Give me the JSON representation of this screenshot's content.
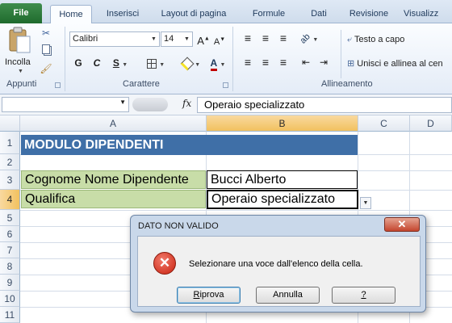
{
  "ribbon_tabs": [
    "File",
    "Home",
    "Inserisci",
    "Layout di pagina",
    "Formule",
    "Dati",
    "Revisione",
    "Visualizz"
  ],
  "clipboard": {
    "paste_label": "Incolla",
    "group_label": "Appunti"
  },
  "font": {
    "name": "Calibri",
    "size": "14",
    "bold": "G",
    "italic": "C",
    "underline": "S",
    "group_label": "Carattere"
  },
  "alignment": {
    "wrap_text": "Testo a capo",
    "merge_center": "Unisci e allinea al cen",
    "group_label": "Allineamento"
  },
  "formula_bar": {
    "name_box": "",
    "fx": "fx",
    "content": "Operaio specializzato"
  },
  "columns": [
    "A",
    "B",
    "C",
    "D"
  ],
  "rows": [
    "1",
    "2",
    "3",
    "4",
    "5",
    "6",
    "7",
    "8",
    "9",
    "10",
    "11"
  ],
  "cells": {
    "a1": "MODULO DIPENDENTI",
    "a3": "Cognome Nome Dipendente",
    "b3": "Bucci Alberto",
    "a4": "Qualifica",
    "b4": "Operaio specializzato"
  },
  "colors": {
    "title_fill": "#3f6fa7",
    "label_fill": "#c8dda8",
    "selected_header": "#f1c15f"
  },
  "dialog": {
    "title": "DATO NON VALIDO",
    "close": "✕",
    "message": "Selezionare una voce dall'elenco della cella.",
    "retry_first": "R",
    "retry_rest": "iprova",
    "cancel": "Annulla",
    "help": "?"
  }
}
